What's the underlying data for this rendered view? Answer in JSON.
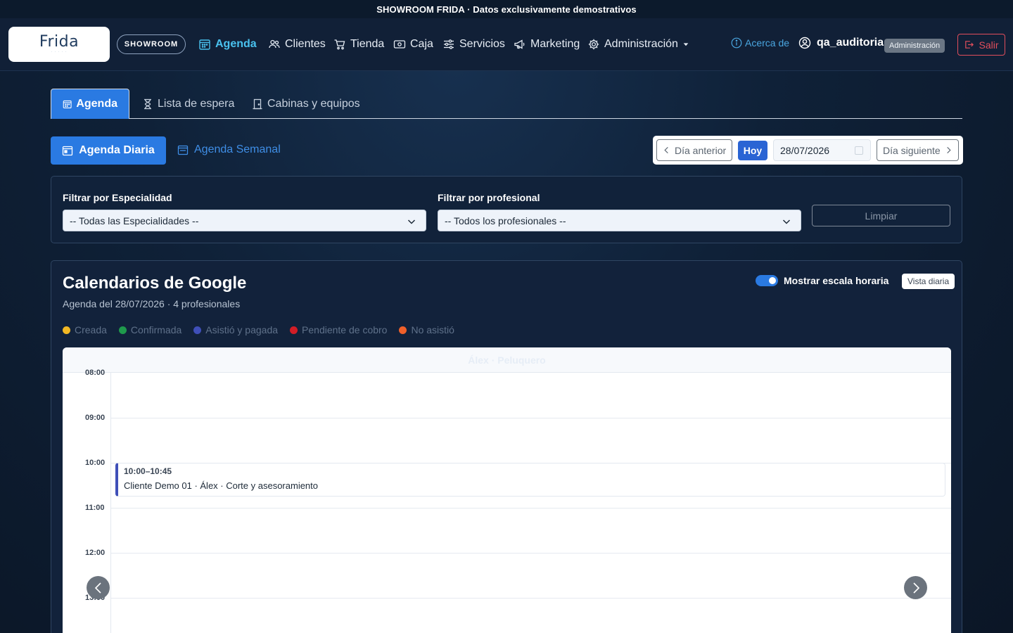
{
  "banner": "SHOWROOM FRIDA · Datos exclusivamente demostrativos",
  "logo": {
    "text": "Frida"
  },
  "showroom_label": "SHOWROOM",
  "nav": {
    "agenda": "Agenda",
    "clientes": "Clientes",
    "tienda": "Tienda",
    "caja": "Caja",
    "servicios": "Servicios",
    "marketing": "Marketing",
    "administracion": "Administración",
    "acerca": "Acerca de",
    "user": "qa_auditoria",
    "role": "Administración",
    "salir": "Salir"
  },
  "tabs": {
    "agenda": "Agenda",
    "lista_espera": "Lista de espera",
    "cabinas": "Cabinas y equipos"
  },
  "views": {
    "daily": "Agenda Diaria",
    "weekly": "Agenda Semanal"
  },
  "date_nav": {
    "prev": "Día anterior",
    "today": "Hoy",
    "date": "28/07/2026",
    "next": "Día siguiente"
  },
  "filters": {
    "specialty_label": "Filtrar por Especialidad",
    "specialty_value": "-- Todas las Especialidades --",
    "professional_label": "Filtrar por profesional",
    "professional_value": "-- Todos los profesionales --",
    "clear": "Limpiar"
  },
  "calendar": {
    "title": "Calendarios de Google",
    "subtitle": "Agenda del 28/07/2026 · 4 profesionales",
    "toggle_label": "Mostrar escala horaria",
    "view_badge": "Vista diaria",
    "column_header": "Álex · Peluquero",
    "legend": [
      {
        "label": "Creada",
        "color": "#f2b824"
      },
      {
        "label": "Confirmada",
        "color": "#1f9a4c"
      },
      {
        "label": "Asistió y pagada",
        "color": "#3f4fb8"
      },
      {
        "label": "Pendiente de cobro",
        "color": "#d21d26"
      },
      {
        "label": "No asistió",
        "color": "#f0602a"
      }
    ],
    "hours": [
      "08:00",
      "09:00",
      "10:00",
      "11:00",
      "12:00",
      "13:00"
    ],
    "event": {
      "time": "10:00–10:45",
      "text": "Cliente Demo 01 · Álex · Corte y asesoramiento"
    }
  },
  "colors": {
    "accent": "#2a7ae2",
    "active_nav": "#49c1ee",
    "danger": "#e14e5c"
  }
}
